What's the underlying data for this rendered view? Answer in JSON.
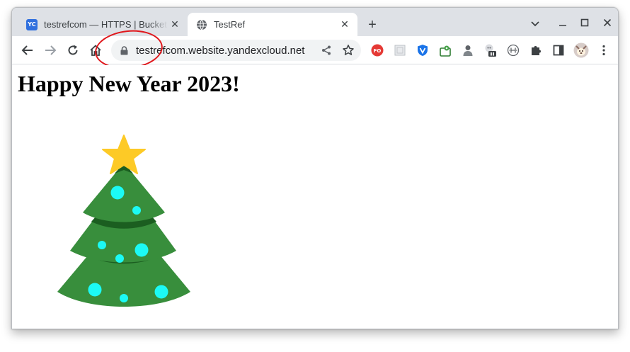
{
  "browser": {
    "tabs": [
      {
        "title": "testrefcom — HTTPS | Bucket",
        "favicon_text": "YC",
        "favicon": "yandex-cloud-icon",
        "active": false
      },
      {
        "title": "TestRef",
        "favicon": "globe-icon",
        "active": true
      }
    ],
    "new_tab_label": "+",
    "window_controls": [
      "chevron-down-icon",
      "minimize-icon",
      "maximize-icon",
      "close-icon"
    ]
  },
  "toolbar": {
    "url": "testrefcom.website.yandexcloud.net",
    "nav_icons": [
      "back-arrow-icon",
      "forward-arrow-icon",
      "reload-icon",
      "home-icon"
    ],
    "extension_fo_label": "FO"
  },
  "page": {
    "heading": "Happy New Year 2023!",
    "image": "christmas-tree-illustration"
  },
  "colors": {
    "tab_strip": "#dee1e6",
    "omnibox": "#f1f3f4",
    "annotation": "#e0161b",
    "tree_green": "#388e3c",
    "tree_dark_green": "#1b5e20",
    "ornament": "#1cfaf5",
    "star": "#fdca26"
  }
}
